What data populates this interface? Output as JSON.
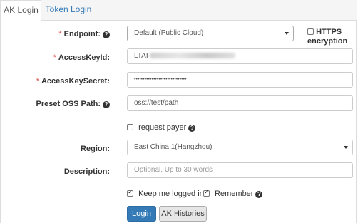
{
  "tabs": {
    "ak_login": "AK Login",
    "token_login": "Token Login"
  },
  "form": {
    "endpoint": {
      "label": "Endpoint:",
      "value": "Default (Public Cloud)"
    },
    "https": {
      "label_line1": "HTTPS",
      "label_line2": "encryption",
      "checked": false
    },
    "access_key_id": {
      "label": "AccessKeyId:",
      "value_prefix": "LTAI"
    },
    "access_key_secret": {
      "label": "AccessKeySecret:",
      "value": "••••••••••••••••••••••••••••••"
    },
    "preset_oss_path": {
      "label": "Preset OSS Path:",
      "value": "oss://test/path"
    },
    "request_payer": {
      "label": "request payer",
      "checked": false
    },
    "region": {
      "label": "Region:",
      "value": "East China 1(Hangzhou)"
    },
    "description": {
      "label": "Description:",
      "placeholder": "Optional, Up to 30 words"
    },
    "keep_logged_in": {
      "label": "Keep me logged in",
      "checked": true
    },
    "remember": {
      "label": "Remember",
      "checked": true
    }
  },
  "buttons": {
    "login": "Login",
    "ak_histories": "AK Histories"
  },
  "required_mark": "*",
  "help_glyph": "?"
}
